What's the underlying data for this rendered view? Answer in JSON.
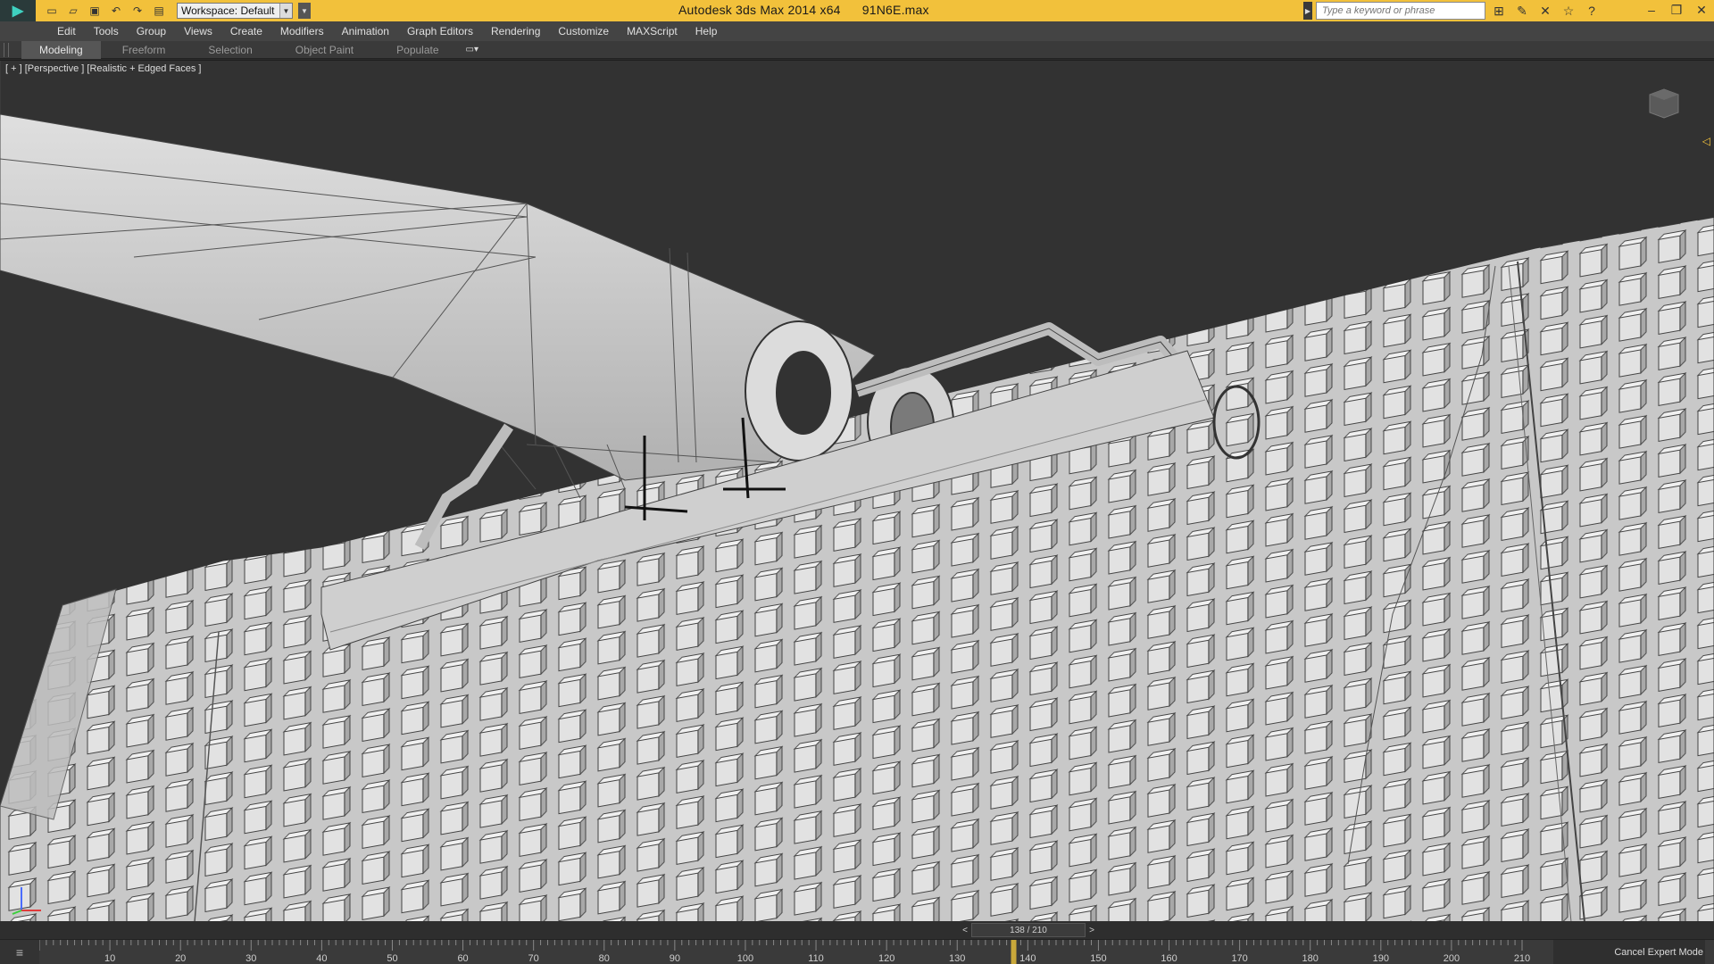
{
  "titlebar": {
    "app_name": "Autodesk 3ds Max  2014 x64",
    "file_name": "91N6E.max",
    "workspace": "Workspace: Default",
    "search_placeholder": "Type a keyword or phrase",
    "colors": {
      "bar": "#f2c13b"
    }
  },
  "quick_access": [
    "new-icon",
    "open-icon",
    "save-icon",
    "undo-icon",
    "redo-icon",
    "project-icon"
  ],
  "menu": [
    "Edit",
    "Tools",
    "Group",
    "Views",
    "Create",
    "Modifiers",
    "Animation",
    "Graph Editors",
    "Rendering",
    "Customize",
    "MAXScript",
    "Help"
  ],
  "ribbon": {
    "tabs": [
      "Modeling",
      "Freeform",
      "Selection",
      "Object Paint",
      "Populate"
    ],
    "active": "Modeling"
  },
  "viewport": {
    "label": "[ + ] [Perspective ] [Realistic + Edged Faces ]"
  },
  "timeslider": {
    "prev": "<",
    "frame": "138 / 210",
    "next": ">",
    "current_frame": 138,
    "total_frames": 210
  },
  "trackbar": {
    "ticks": [
      "10",
      "20",
      "30",
      "40",
      "50",
      "60",
      "70",
      "80",
      "90",
      "100",
      "110",
      "120",
      "130",
      "140",
      "150",
      "160",
      "170",
      "180",
      "190",
      "200",
      "210"
    ]
  },
  "status": {
    "expert_mode": "Cancel Expert Mode"
  }
}
